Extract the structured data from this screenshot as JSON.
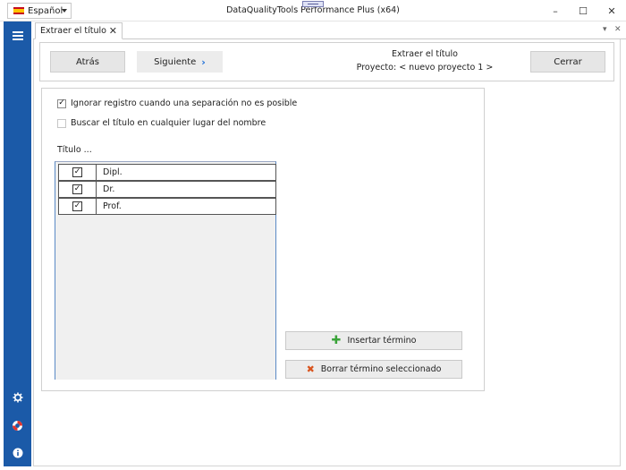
{
  "titlebar": {
    "language": "Español",
    "app_title": "DataQualityTools Performance Plus (x64)",
    "minimize": "–",
    "maximize": "☐",
    "close": "✕"
  },
  "tab": {
    "label": "Extraer el título",
    "close": "✕",
    "dropdown_glyph": "▾",
    "close_pane_glyph": "✕"
  },
  "nav": {
    "back_label": "Atrás",
    "next_label": "Siguiente",
    "next_arrow": "›",
    "title": "Extraer el título",
    "project": "Proyecto: < nuevo proyecto 1 >",
    "close_label": "Cerrar"
  },
  "options": {
    "ignore_record": {
      "label": "Ignorar registro cuando una separación no es posible",
      "checked": true
    },
    "search_anywhere": {
      "label": "Buscar el título en cualquier lugar del nombre",
      "checked": false
    }
  },
  "titles": {
    "section_label": "Título ...",
    "rows": [
      {
        "checked": true,
        "term": "Dipl."
      },
      {
        "checked": true,
        "term": "Dr."
      },
      {
        "checked": true,
        "term": "Prof."
      }
    ]
  },
  "actions": {
    "insert_label": "Insertar término",
    "delete_label": "Borrar término seleccionado"
  },
  "sidebar": {
    "icons": [
      "menu-icon",
      "gear-icon",
      "lifebuoy-icon",
      "info-icon"
    ]
  },
  "colors": {
    "sidebar": "#1b5aa8",
    "accent_chevron": "#1e6fd9",
    "plus_green": "#3aa339",
    "delete_orange": "#d9541e"
  }
}
